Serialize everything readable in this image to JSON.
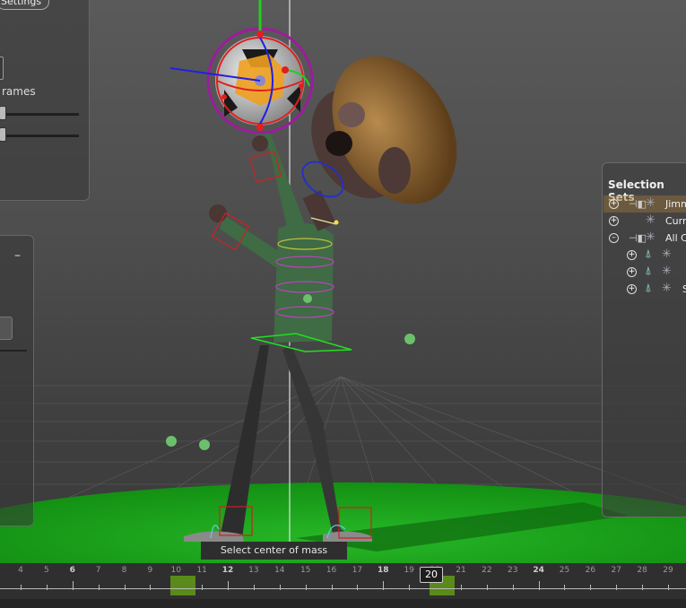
{
  "left_panel": {
    "settings_label": "Settings",
    "frames_label": "rames",
    "collapse_symbol": "–"
  },
  "selection_sets": {
    "title": "Selection Sets",
    "rows": [
      {
        "label": "Jimm",
        "expand": "+"
      },
      {
        "label": "Curr",
        "expand": "+"
      },
      {
        "label": "All C",
        "expand": "–"
      },
      {
        "label": "",
        "expand": "+"
      },
      {
        "label": "",
        "expand": "+"
      },
      {
        "label": "S",
        "expand": "+"
      }
    ]
  },
  "tooltip": "Select center of mass controls",
  "timeline": {
    "ticks": [
      "4",
      "5",
      "6",
      "7",
      "8",
      "9",
      "10",
      "11",
      "12",
      "13",
      "14",
      "15",
      "16",
      "17",
      "18",
      "19",
      "20",
      "21",
      "22",
      "23",
      "24",
      "25",
      "26",
      "27",
      "28",
      "29"
    ],
    "major_ticks": [
      "6",
      "12",
      "18",
      "24"
    ],
    "current_frame": "20",
    "key_frames": [
      "10",
      "20"
    ]
  },
  "colors": {
    "ground": "#1fa31f",
    "key_marker": "#5a8a1a",
    "tooltip_bg": "#2e2e2e"
  }
}
